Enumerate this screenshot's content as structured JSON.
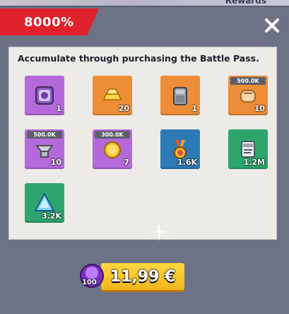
{
  "background": {
    "label": "Rewards"
  },
  "banner": {
    "text": "8000%"
  },
  "description": "Accumulate through purchasing the Battle Pass.",
  "items": [
    {
      "name": "cube-item",
      "icon": "purple-cube-icon",
      "color": "purple",
      "qty": "1",
      "cap": ""
    },
    {
      "name": "gold-bar-item",
      "icon": "gold-bars-icon",
      "color": "orange",
      "qty": "20",
      "cap": ""
    },
    {
      "name": "gauntlet-item",
      "icon": "metal-gauntlet-icon",
      "color": "orange",
      "qty": "1",
      "cap": ""
    },
    {
      "name": "bread-item",
      "icon": "bread-icon",
      "color": "orange",
      "qty": "10",
      "cap": "500.0K"
    },
    {
      "name": "iron-item",
      "icon": "iron-ingot-icon",
      "color": "purple",
      "qty": "10",
      "cap": "500.0K"
    },
    {
      "name": "coin-item",
      "icon": "gold-coin-icon",
      "color": "purple",
      "qty": "7",
      "cap": "300.0K"
    },
    {
      "name": "medal-item",
      "icon": "medal-icon",
      "color": "blue",
      "qty": "1.6K",
      "cap": ""
    },
    {
      "name": "exp-item",
      "icon": "exp-ticket-icon",
      "color": "green",
      "qty": "1.2M",
      "cap": ""
    },
    {
      "name": "crystal-item",
      "icon": "blue-crystal-icon",
      "color": "green",
      "qty": "3.2K",
      "cap": ""
    }
  ],
  "purchase": {
    "price": "11,99 €",
    "bonus_gems": "100"
  },
  "colors": {
    "banner_red": "#e0202b",
    "purple": "#b469da",
    "orange": "#ed8d38",
    "blue": "#2d7bb6",
    "green": "#2fa56e",
    "button_yellow": "#ffd742"
  }
}
